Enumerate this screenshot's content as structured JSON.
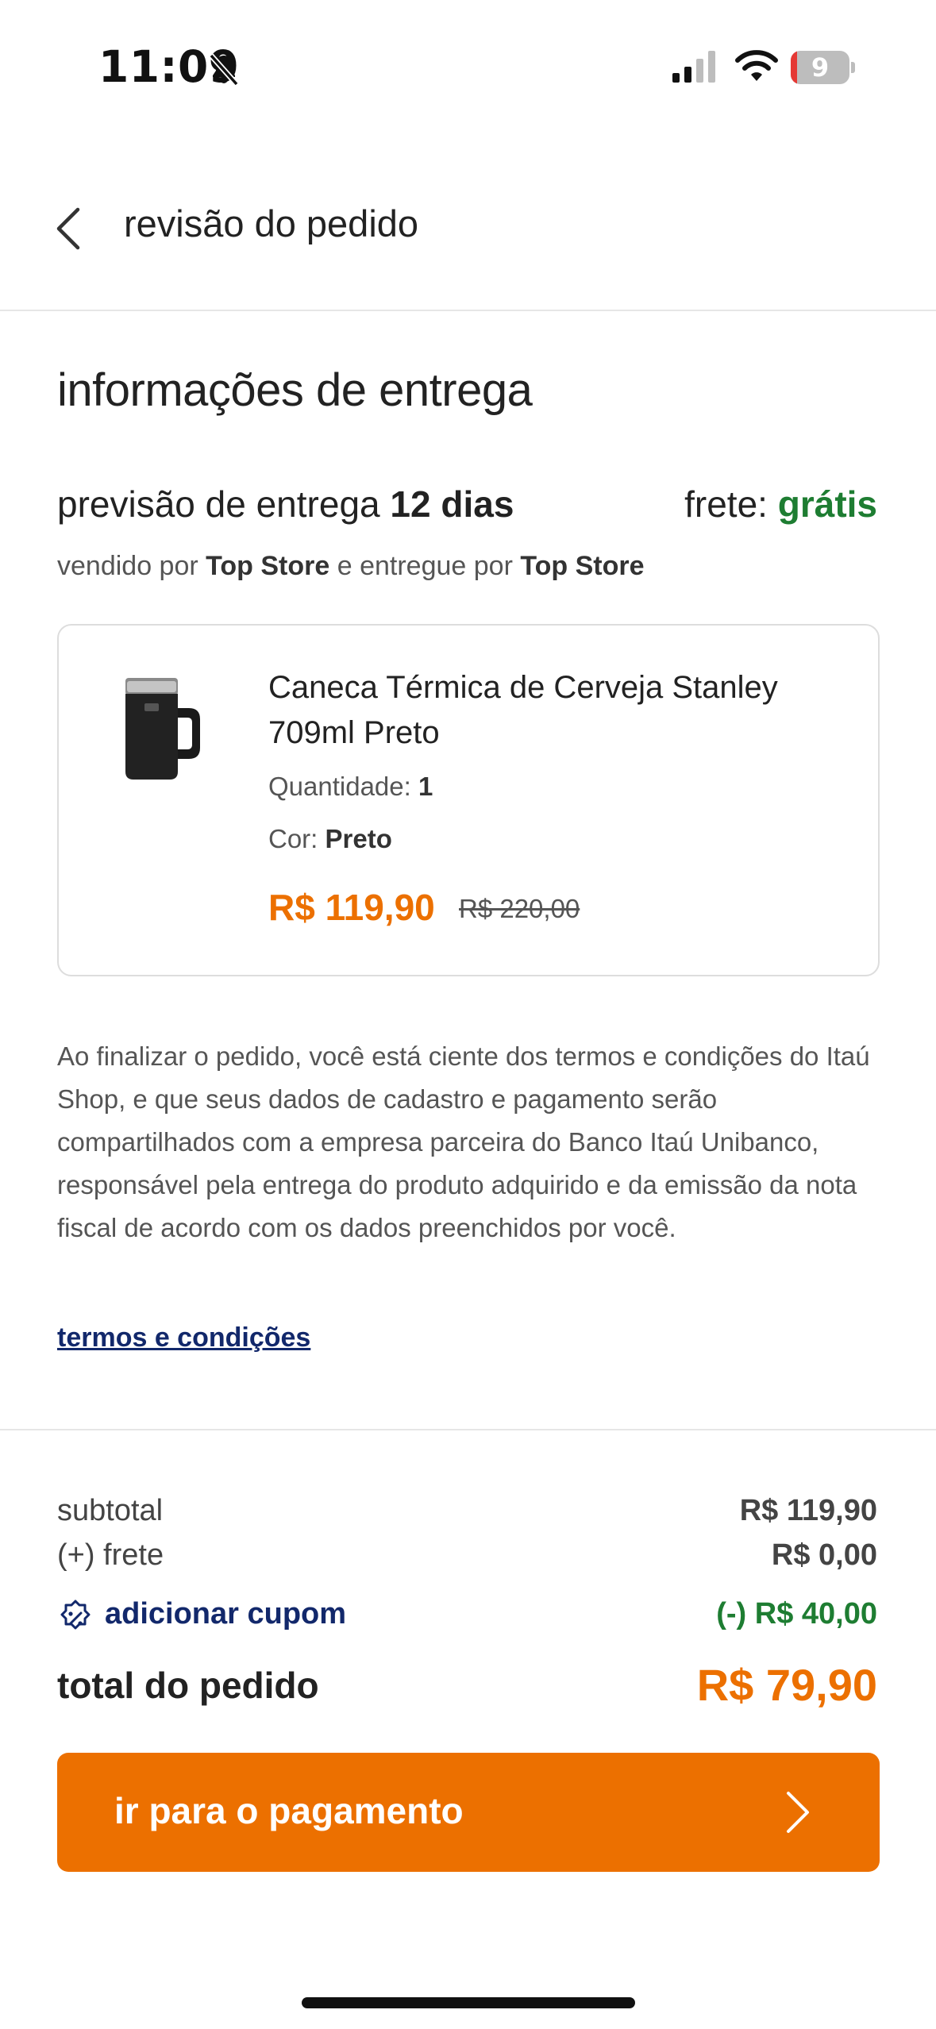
{
  "status_bar": {
    "time": "11:09",
    "battery": "9",
    "icons": [
      "bell-slash-icon",
      "cellular-signal-icon",
      "wifi-icon",
      "battery-icon"
    ]
  },
  "header": {
    "title": "revisão do pedido",
    "back_icon": "chevron-left-icon"
  },
  "delivery": {
    "section_title": "informações de entrega",
    "estimate_prefix": "previsão de entrega",
    "estimate_value": "12 dias",
    "shipping_label": "frete:",
    "shipping_value": "grátis",
    "sold_by_prefix": "vendido por",
    "sold_by": "Top Store",
    "delivered_by_prefix": "e entregue por",
    "delivered_by": "Top Store"
  },
  "product": {
    "name": "Caneca Térmica de Cerveja Stanley 709ml Preto",
    "quantity_label": "Quantidade:",
    "quantity": "1",
    "color_label": "Cor:",
    "color": "Preto",
    "price": "R$ 119,90",
    "old_price": "R$ 220,00"
  },
  "legal": {
    "text": "Ao finalizar o pedido, você está ciente dos termos e condições do Itaú Shop, e que seus dados de cadastro e pagamento serão compartilhados com a empresa parceira do Banco Itaú Unibanco, responsável pela entrega do produto adquirido e da emissão da nota fiscal de acordo com os dados preenchidos por você.",
    "terms_link": "termos e condições"
  },
  "summary": {
    "subtotal_label": "subtotal",
    "subtotal_value": "R$ 119,90",
    "shipping_label": "(+) frete",
    "shipping_value": "R$ 0,00",
    "coupon_label": "adicionar cupom",
    "discount_value": "(-) R$ 40,00",
    "total_label": "total do pedido",
    "total_value": "R$ 79,90"
  },
  "payment_button": {
    "label": "ir para o pagamento"
  },
  "colors": {
    "accent": "#ec7000",
    "green": "#1e7d32",
    "link": "#12286b"
  }
}
